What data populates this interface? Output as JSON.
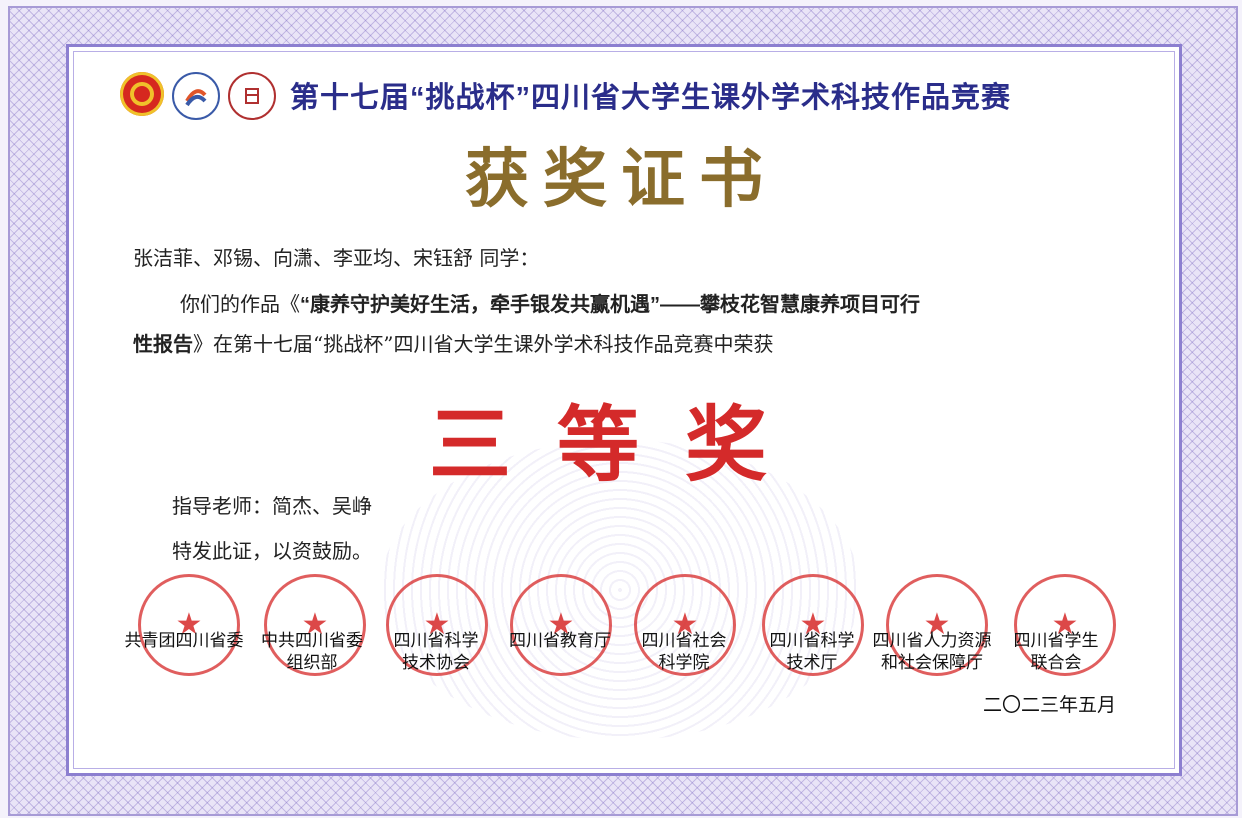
{
  "header": {
    "competition_title": "第十七届“挑战杯”四川省大学生课外学术科技作品竞赛",
    "certificate_title": "获奖证书"
  },
  "logos": [
    "youth-league-emblem-icon",
    "challenge-cup-logo-icon",
    "university-seal-icon"
  ],
  "body": {
    "recipients": "张洁菲、邓锡、向潇、李亚均、宋钰舒  同学：",
    "intro_prefix": "你们的作品《",
    "work_title_part1": "“康养守护美好生活，牵手银发共赢机遇”——攀枝花智慧康养项目可行",
    "work_title_part2": "性报告",
    "intro_suffix": "》在第十七届“挑战杯”四川省大学生课外学术科技作品竞赛中荣获",
    "award": "三等奖",
    "advisor_label": "指导老师：",
    "advisor_names": "简杰、吴峥",
    "closing": "特发此证，以资鼓励。"
  },
  "issuers": [
    {
      "line1": "共青团四川省委",
      "line2": ""
    },
    {
      "line1": "中共四川省委",
      "line2": "组织部"
    },
    {
      "line1": "四川省科学",
      "line2": "技术协会"
    },
    {
      "line1": "四川省教育厅",
      "line2": ""
    },
    {
      "line1": "四川省社会",
      "line2": "科学院"
    },
    {
      "line1": "四川省科学",
      "line2": "技术厅"
    },
    {
      "line1": "四川省人力资源",
      "line2": "和社会保障厅"
    },
    {
      "line1": "四川省学生",
      "line2": "联合会"
    }
  ],
  "date": "二〇二三年五月",
  "colors": {
    "title_blue": "#2a2d8a",
    "certificate_gold": "#8a6d2c",
    "award_red": "#d42a2a",
    "seal_red": "#d62828",
    "frame_purple": "#8c7fd0"
  }
}
